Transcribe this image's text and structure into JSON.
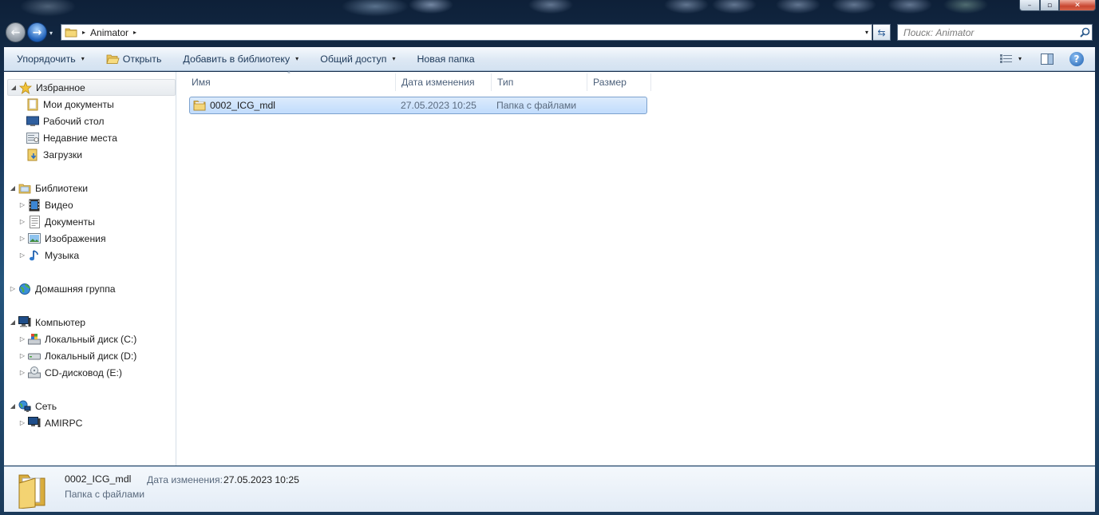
{
  "window": {
    "caption_buttons": {
      "minimize": "–",
      "maximize": "▫",
      "close": "✕"
    }
  },
  "nav": {
    "back_icon": "back-arrow-icon",
    "forward_icon": "forward-arrow-icon",
    "back_glyph": "←",
    "forward_glyph": "→",
    "history_glyph": "▾",
    "address_separator": "▸",
    "address_path": "Animator",
    "address_dropdown": "▾",
    "refresh_glyph": "⇆",
    "search_placeholder": "Поиск: Animator"
  },
  "toolbar": {
    "organize": "Упорядочить",
    "open": "Открыть",
    "add_to_library": "Добавить в библиотеку",
    "share": "Общий доступ",
    "new_folder": "Новая папка",
    "caret": "▾",
    "help": "?"
  },
  "sidebar": {
    "favorites": {
      "label": "Избранное",
      "items": [
        "Мои документы",
        "Рабочий стол",
        "Недавние места",
        "Загрузки"
      ]
    },
    "libraries": {
      "label": "Библиотеки",
      "items": [
        "Видео",
        "Документы",
        "Изображения",
        "Музыка"
      ]
    },
    "homegroup": {
      "label": "Домашняя группа"
    },
    "computer": {
      "label": "Компьютер",
      "items": [
        "Локальный диск (C:)",
        "Локальный диск (D:)",
        "CD-дисковод (E:)"
      ]
    },
    "network": {
      "label": "Сеть",
      "items": [
        "AMIRPC"
      ]
    },
    "expanded_glyph": "◢",
    "collapsed_glyph": "▷"
  },
  "columns": {
    "name": "Имя",
    "date": "Дата изменения",
    "type": "Тип",
    "size": "Размер",
    "sort_glyph": "ⱏ"
  },
  "files": [
    {
      "name": "0002_ICG_mdl",
      "date": "27.05.2023 10:25",
      "type": "Папка с файлами",
      "size": "",
      "selected": true
    }
  ],
  "details": {
    "name": "0002_ICG_mdl",
    "type": "Папка с файлами",
    "date_label": "Дата изменения:",
    "date": "27.05.2023 10:25"
  },
  "colors": {
    "accent": "#1d5fb8",
    "selection_fill": "#c7defa",
    "selection_border": "#7da2ce"
  }
}
